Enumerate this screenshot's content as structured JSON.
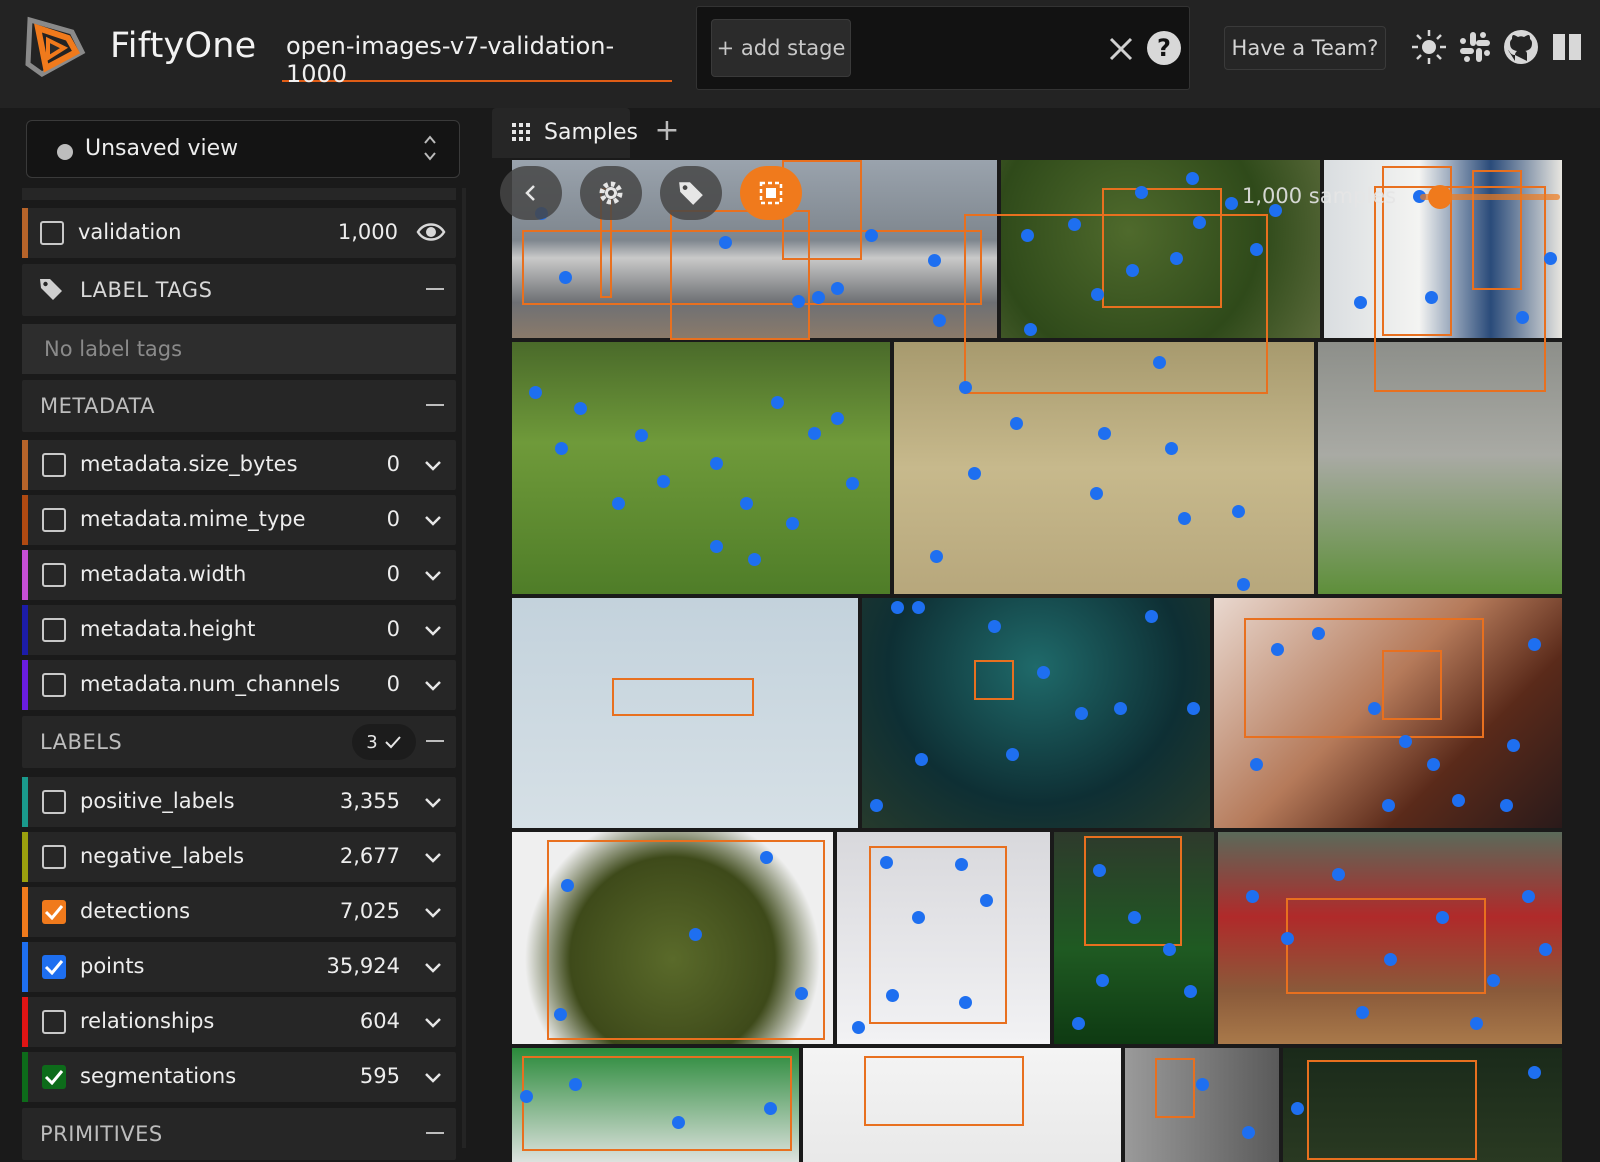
{
  "header": {
    "brand": "FiftyOne",
    "dataset_name": "open-images-v7-validation-1000",
    "add_stage_label": "+ add stage",
    "help_label": "?",
    "team_button": "Have a Team?",
    "accent_color": "#e05d16",
    "icons": [
      "theme-toggle-icon",
      "slack-icon",
      "github-icon",
      "docs-icon"
    ]
  },
  "sidebar": {
    "view_selector": "Unsaved view",
    "split_row": {
      "label": "validation",
      "count": "1,000",
      "color": "#b7642a"
    },
    "label_tags_section": "LABEL TAGS",
    "label_tags_empty": "No label tags",
    "metadata_section": "METADATA",
    "metadata_fields": [
      {
        "label": "metadata.size_bytes",
        "count": "0",
        "color": "#b7642a"
      },
      {
        "label": "metadata.mime_type",
        "count": "0",
        "color": "#b04a12"
      },
      {
        "label": "metadata.width",
        "count": "0",
        "color": "#c64ed6"
      },
      {
        "label": "metadata.height",
        "count": "0",
        "color": "#1c1ca8"
      },
      {
        "label": "metadata.num_channels",
        "count": "0",
        "color": "#6a1de0"
      }
    ],
    "labels_section": "LABELS",
    "labels_badge": "3",
    "label_fields": [
      {
        "label": "positive_labels",
        "count": "3,355",
        "color": "#1a9a8c",
        "checked": false
      },
      {
        "label": "negative_labels",
        "count": "2,677",
        "color": "#9aa00e",
        "checked": false
      },
      {
        "label": "detections",
        "count": "7,025",
        "color": "#f07a1c",
        "checked": true
      },
      {
        "label": "points",
        "count": "35,924",
        "color": "#1e6ff0",
        "checked": true
      },
      {
        "label": "relationships",
        "count": "604",
        "color": "#e01414",
        "checked": false
      },
      {
        "label": "segmentations",
        "count": "595",
        "color": "#0d6b1a",
        "checked": true
      }
    ],
    "primitives_section": "PRIMITIVES"
  },
  "main": {
    "tab_label": "Samples",
    "sample_count": "1,000 samples"
  }
}
